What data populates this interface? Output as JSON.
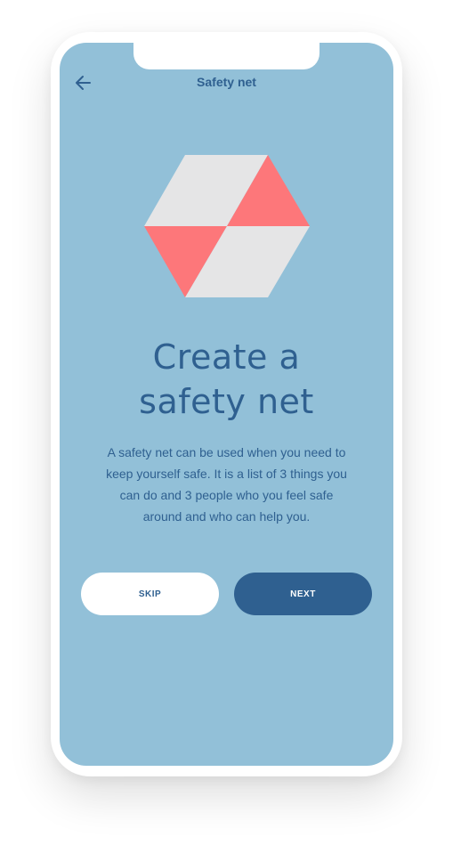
{
  "header": {
    "title": "Safety net",
    "back_icon": "arrow-left-icon"
  },
  "illustration": {
    "icon": "hexagon-cube-icon",
    "colors": {
      "light": "#e5e5e6",
      "accent": "#fd777a"
    }
  },
  "content": {
    "headline_line1": "Create a",
    "headline_line2": "safety net",
    "description": "A safety net can be used when you need to keep yourself safe. It is a list of 3 things you can do and 3 people who you feel safe around and who can help you."
  },
  "actions": {
    "skip_label": "SKIP",
    "next_label": "NEXT"
  },
  "theme": {
    "background": "#92c0d8",
    "primary": "#2f6090",
    "white": "#ffffff"
  }
}
